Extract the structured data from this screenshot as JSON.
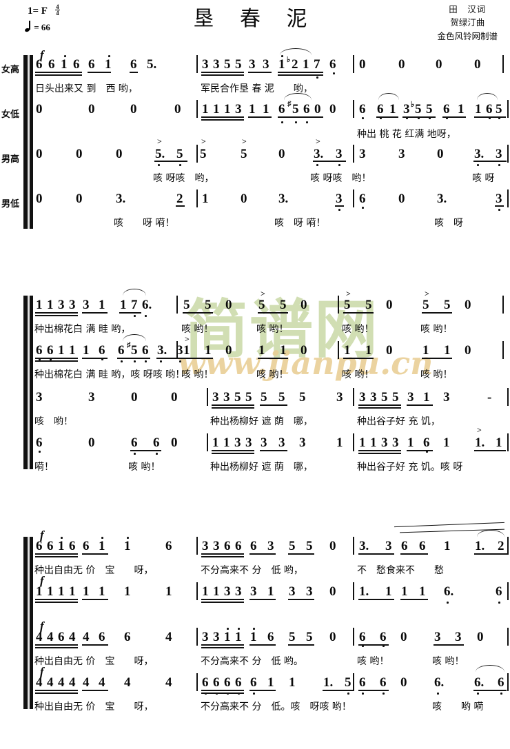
{
  "header": {
    "key_signature": "1= F",
    "time_numerator": "4",
    "time_denominator": "4",
    "tempo_value": "= 66",
    "title": "垦 春 泥",
    "lyricist": "田　汉词",
    "composer": "贺绿汀曲",
    "engraver": "金色风铃网制谱"
  },
  "watermark": {
    "text_cn": "简谱网",
    "text_url": "www.jianpu.cn"
  },
  "voices": {
    "soprano": "女高",
    "alto": "女低",
    "tenor": "男高",
    "bass": "男低"
  },
  "dynamics": {
    "forte": "f"
  },
  "systems": [
    {
      "id": "system-1",
      "parts": [
        {
          "voice": "soprano",
          "dynamic": "f",
          "notes": "6 6 1̇ 6 | 6 1̇ | 6 5. ‖ 3 3 5 5 3 3 | 1̇ ♭2̇ 1̇ 7 | 6̣ ‖ 0  0  0  0",
          "lyrics": "日头出来又 到　西 哟，　　军民合作垦 春 泥　　哟，"
        },
        {
          "voice": "alto",
          "notes": "0  0  0  0 ‖ 1 1 1 3 1 1 | 6̣ ♯5̣ 6̣ 0 | 0 ‖ 6̣ 6̣1 3̣ ♭5 5 | 6̣ 1 | 1 6̣ 5̣",
          "lyrics": "种出 桃 花 红满 地呀，"
        },
        {
          "voice": "tenor",
          "notes": "0  0  0  5̣. 5̣ ‖ 5 5 0 3. 3 ‖ 3 3 0 3. 3",
          "lyrics": "咳 呀咳　哟，　咳 呀咳　哟！　　咳 呀"
        },
        {
          "voice": "bass",
          "notes": "0  0  3.  2 ‖ 1  0  3.  3̣ ‖ 6̣  0  3.  3̣",
          "lyrics": "咳　　呀 嗬！　　咳　呀　嗬！　　咳　呀"
        }
      ]
    },
    {
      "id": "system-2",
      "parts": [
        {
          "voice": "soprano",
          "notes": "1 1 3 3 3 1 | 1 7̣ 6̣. ‖ 5 5 0 5 5 0 ‖ 5 5 0 5 5 0",
          "lyrics": "种出棉花白 满 畦 哟，　　咳 哟！　咳 哟！　咳 哟！　咳 哟！"
        },
        {
          "voice": "alto",
          "notes": "6̣ 6̣ 1 1 1 6̣ | 6̣ ♯5̣ 6̣ 3. 3 ‖ 1 1 0 1 1 0 ‖ 1 1 0 1 1 0",
          "lyrics": "种出棉花白 满 畦 哟，咳 呀咳 哟！　咳 哟！　咳 哟！　咳 哟！　咳 哟！"
        },
        {
          "voice": "tenor",
          "notes": "3  3  0  0 ‖ 3 3 5 5 5 5 5 3 ‖ 3 3 5 5 3 1 3  -",
          "lyrics": "咳　哟！　　种出杨柳好 遮 荫　哪，　种出谷子好 充 饥，"
        },
        {
          "voice": "bass",
          "notes": "6̣  0  6̣ 6̣ 0 ‖ 1 1 3 3 3 3 3  1 ‖ 1 1 3 3 1 6̣ 1  1. 1",
          "lyrics": "嗬！　咳 哟！　种出杨柳好 遮 荫　哪，　种出谷子好 充 饥。咳 呀"
        }
      ]
    },
    {
      "id": "system-3",
      "parts": [
        {
          "voice": "soprano",
          "dynamic": "f",
          "notes": "6 6 1̇ 6 6 1̇ | 1̇  6 ‖ 3 3 6 6 6 3 5 5 0 ‖ 3. 3 6 6 1  1. 2",
          "lyrics": "种出自由无 价　宝　　呀，　不分高来不 分　低 哟，　不　愁食来不　　愁"
        },
        {
          "voice": "alto",
          "dynamic": "f",
          "notes": "1 1 1 1 1 1 | 1  1 ‖ 1 1 3 3 3 1 3 3 0 ‖ 1. 1 1 1 6̣.  6̣",
          "lyrics": ""
        },
        {
          "voice": "tenor",
          "dynamic": "f",
          "notes": "4 4 6 4 4 6 | 6  4 ‖ 3 3 1̇ 1̇ 1̇ 6 5 5 0 ‖ 6̣ 6̣ 0 3 3 0",
          "lyrics": "种出自由无 价　宝　　呀，　不分高来不 分　低 哟。　咳 哟！　咳 哟！"
        },
        {
          "voice": "bass",
          "dynamic": "f",
          "notes": "4 4 4 4 4 4 | 4  4 ‖ 6̣ 6̣ 6̣ 6̣ 6̣ 1 1  1. 5̣ ‖ 6̣ 6̣ 0 6̣.  6̣. 6̣",
          "lyrics": "种出自由无 价　宝　　呀，　不分高来不 分　低。咳　呀咳 哟！　咳　　哟 嗬"
        }
      ]
    }
  ]
}
